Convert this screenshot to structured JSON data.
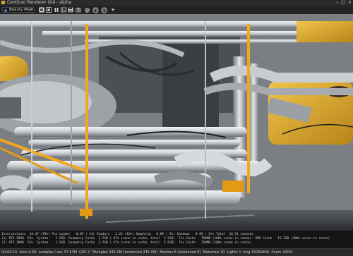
{
  "window": {
    "title": "CentiLeo Renderer GUI - alpha",
    "minimize": "–",
    "maximize": "□",
    "close": "×"
  },
  "toolbar": {
    "pass_select_value": "Beauty Main",
    "pass_select_caret": "▾",
    "buttons": [
      "render-start-icon",
      "render-stop-icon",
      "pause-icon",
      "image-icon",
      "save-icon",
      "camera-icon",
      "settings-gear-icon",
      "rotate-ccw-icon",
      "rotate-cw-icon",
      "dropdown-icon"
    ]
  },
  "stats": {
    "line1": "Intersections  14.47 (78%) Tex Loader   0.09 ( 1%) Shaders   2.23 (12%) Sampling   0.89 ( 5%) Shadows   0.99 ( 5%) Total  18.51 seconds",
    "line2": "(1) RTX 3090  51%  System    1.5GB  Geometry Cache  3.7GB ( 47% scene in cache, total  2.5GB)  Tex Cache   768MB (100% scene in cache)  VRP Cache   15.7GB (100% scene in cache)",
    "line3": "(2) RTX 3090  51%  System    1.5GB  Geometry Cache  3.7GB ( 47% scene in cache, total  2.5GB)  Tex Cache   768MB (100% scene in cache)"
  },
  "statusbar": {
    "left": "00:00:15  Iters 4.00  samples / sec 37.63M",
    "right": "GPU 2  Triangles 245.0M (instanced 245.0M)  Meshes 6 (instanced 6)  Materials 10  Lights 1  Img 1600x900  Zoom 100%"
  },
  "colors": {
    "accent_orange": "#f2a81e",
    "pipe_light": "#d9dde2",
    "pipe_mid": "#a9adb3",
    "pipe_dark": "#5c6066",
    "yellow_tank": "#e6b63a"
  }
}
